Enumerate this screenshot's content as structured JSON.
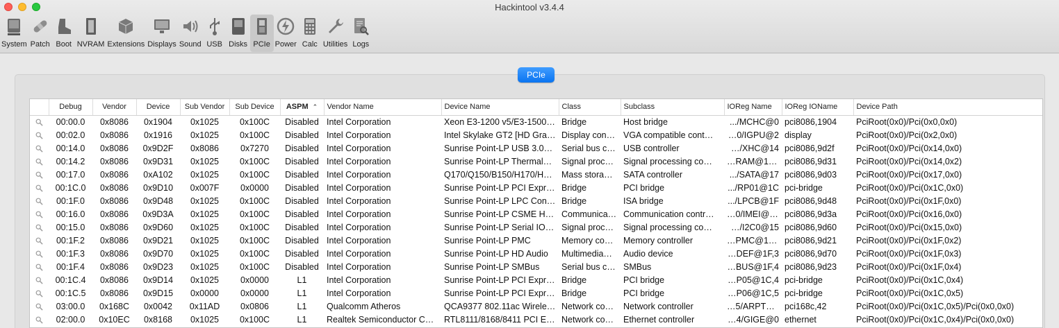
{
  "window": {
    "title": "Hackintool v3.4.4"
  },
  "toolbar": {
    "items": [
      {
        "label": "System",
        "icon": "system-icon"
      },
      {
        "label": "Patch",
        "icon": "patch-icon"
      },
      {
        "label": "Boot",
        "icon": "boot-icon"
      },
      {
        "label": "NVRAM",
        "icon": "nvram-icon"
      },
      {
        "label": "Extensions",
        "icon": "extensions-icon"
      },
      {
        "label": "Displays",
        "icon": "displays-icon"
      },
      {
        "label": "Sound",
        "icon": "sound-icon"
      },
      {
        "label": "USB",
        "icon": "usb-icon"
      },
      {
        "label": "Disks",
        "icon": "disks-icon"
      },
      {
        "label": "PCIe",
        "icon": "pcie-icon",
        "selected": true
      },
      {
        "label": "Power",
        "icon": "power-icon"
      },
      {
        "label": "Calc",
        "icon": "calc-icon"
      },
      {
        "label": "Utilities",
        "icon": "utilities-icon"
      },
      {
        "label": "Logs",
        "icon": "logs-icon"
      }
    ]
  },
  "segment": {
    "label": "PCIe"
  },
  "table": {
    "columns": [
      "",
      "Debug",
      "Vendor",
      "Device",
      "Sub Vendor",
      "Sub Device",
      "ASPM",
      "Vendor Name",
      "Device Name",
      "Class",
      "Subclass",
      "IOReg Name",
      "IOReg IOName",
      "Device Path"
    ],
    "sorted_column": "ASPM",
    "sort_direction": "ascending",
    "rows": [
      [
        "00:00.0",
        "0x8086",
        "0x1904",
        "0x1025",
        "0x100C",
        "Disabled",
        "Intel Corporation",
        "Xeon E3-1200 v5/E3-1500…",
        "Bridge",
        "Host bridge",
        ".../MCHC@0",
        "pci8086,1904",
        "PciRoot(0x0)/Pci(0x0,0x0)"
      ],
      [
        "00:02.0",
        "0x8086",
        "0x1916",
        "0x1025",
        "0x100C",
        "Disabled",
        "Intel Corporation",
        "Intel Skylake GT2 [HD Gra…",
        "Display con…",
        "VGA compatible cont…",
        "…0/IGPU@2",
        "display",
        "PciRoot(0x0)/Pci(0x2,0x0)"
      ],
      [
        "00:14.0",
        "0x8086",
        "0x9D2F",
        "0x8086",
        "0x7270",
        "Disabled",
        "Intel Corporation",
        "Sunrise Point-LP USB 3.0…",
        "Serial bus c…",
        "USB controller",
        "…/XHC@14",
        "pci8086,9d2f",
        "PciRoot(0x0)/Pci(0x14,0x0)"
      ],
      [
        "00:14.2",
        "0x8086",
        "0x9D31",
        "0x1025",
        "0x100C",
        "Disabled",
        "Intel Corporation",
        "Sunrise Point-LP Thermal…",
        "Signal proc…",
        "Signal processing co…",
        "…RAM@14,2",
        "pci8086,9d31",
        "PciRoot(0x0)/Pci(0x14,0x2)"
      ],
      [
        "00:17.0",
        "0x8086",
        "0xA102",
        "0x1025",
        "0x100C",
        "Disabled",
        "Intel Corporation",
        "Q170/Q150/B150/H170/H11…",
        "Mass stora…",
        "SATA controller",
        ".../SATA@17",
        "pci8086,9d03",
        "PciRoot(0x0)/Pci(0x17,0x0)"
      ],
      [
        "00:1C.0",
        "0x8086",
        "0x9D10",
        "0x007F",
        "0x0000",
        "Disabled",
        "Intel Corporation",
        "Sunrise Point-LP PCI Expr…",
        "Bridge",
        "PCI bridge",
        ".../RP01@1C",
        "pci-bridge",
        "PciRoot(0x0)/Pci(0x1C,0x0)"
      ],
      [
        "00:1F.0",
        "0x8086",
        "0x9D48",
        "0x1025",
        "0x100C",
        "Disabled",
        "Intel Corporation",
        "Sunrise Point-LP LPC Cont…",
        "Bridge",
        "ISA bridge",
        ".../LPCB@1F",
        "pci8086,9d48",
        "PciRoot(0x0)/Pci(0x1F,0x0)"
      ],
      [
        "00:16.0",
        "0x8086",
        "0x9D3A",
        "0x1025",
        "0x100C",
        "Disabled",
        "Intel Corporation",
        "Sunrise Point-LP CSME HE…",
        "Communica…",
        "Communication contr…",
        "…0/IMEI@16",
        "pci8086,9d3a",
        "PciRoot(0x0)/Pci(0x16,0x0)"
      ],
      [
        "00:15.0",
        "0x8086",
        "0x9D60",
        "0x1025",
        "0x100C",
        "Disabled",
        "Intel Corporation",
        "Sunrise Point-LP Serial IO I…",
        "Signal proc…",
        "Signal processing co…",
        "…/I2C0@15",
        "pci8086,9d60",
        "PciRoot(0x0)/Pci(0x15,0x0)"
      ],
      [
        "00:1F.2",
        "0x8086",
        "0x9D21",
        "0x1025",
        "0x100C",
        "Disabled",
        "Intel Corporation",
        "Sunrise Point-LP PMC",
        "Memory co…",
        "Memory controller",
        "…PMC@1F,2",
        "pci8086,9d21",
        "PciRoot(0x0)/Pci(0x1F,0x2)"
      ],
      [
        "00:1F.3",
        "0x8086",
        "0x9D70",
        "0x1025",
        "0x100C",
        "Disabled",
        "Intel Corporation",
        "Sunrise Point-LP HD Audio",
        "Multimedia…",
        "Audio device",
        "…DEF@1F,3",
        "pci8086,9d70",
        "PciRoot(0x0)/Pci(0x1F,0x3)"
      ],
      [
        "00:1F.4",
        "0x8086",
        "0x9D23",
        "0x1025",
        "0x100C",
        "Disabled",
        "Intel Corporation",
        "Sunrise Point-LP SMBus",
        "Serial bus c…",
        "SMBus",
        "…BUS@1F,4",
        "pci8086,9d23",
        "PciRoot(0x0)/Pci(0x1F,0x4)"
      ],
      [
        "00:1C.4",
        "0x8086",
        "0x9D14",
        "0x1025",
        "0x0000",
        "L1",
        "Intel Corporation",
        "Sunrise Point-LP PCI Expr…",
        "Bridge",
        "PCI bridge",
        "…P05@1C,4",
        "pci-bridge",
        "PciRoot(0x0)/Pci(0x1C,0x4)"
      ],
      [
        "00:1C.5",
        "0x8086",
        "0x9D15",
        "0x0000",
        "0x0000",
        "L1",
        "Intel Corporation",
        "Sunrise Point-LP PCI Expr…",
        "Bridge",
        "PCI bridge",
        "…P06@1C,5",
        "pci-bridge",
        "PciRoot(0x0)/Pci(0x1C,0x5)"
      ],
      [
        "03:00.0",
        "0x168C",
        "0x0042",
        "0x11AD",
        "0x0806",
        "L1",
        "Qualcomm Atheros",
        "QCA9377 802.11ac Wirele…",
        "Network co…",
        "Network controller",
        "…5/ARPT@0",
        "pci168c,42",
        "PciRoot(0x0)/Pci(0x1C,0x5)/Pci(0x0,0x0)"
      ],
      [
        "02:00.0",
        "0x10EC",
        "0x8168",
        "0x1025",
        "0x100C",
        "L1",
        "Realtek Semiconductor Co…",
        "RTL8111/8168/8411 PCI Ex…",
        "Network co…",
        "Ethernet controller",
        "…4/GIGE@0",
        "ethernet",
        "PciRoot(0x0)/Pci(0x1C,0x4)/Pci(0x0,0x0)"
      ]
    ]
  }
}
